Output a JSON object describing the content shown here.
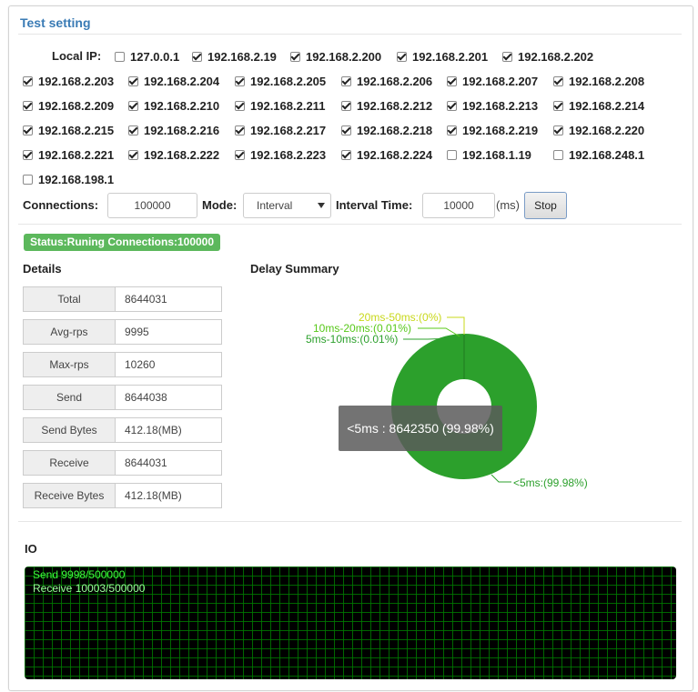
{
  "panel": {
    "title": "Test setting"
  },
  "local_ip": {
    "label": "Local IP:",
    "items": [
      {
        "ip": "127.0.0.1",
        "checked": false
      },
      {
        "ip": "192.168.2.19",
        "checked": true
      },
      {
        "ip": "192.168.2.200",
        "checked": true
      },
      {
        "ip": "192.168.2.201",
        "checked": true
      },
      {
        "ip": "192.168.2.202",
        "checked": true
      },
      {
        "ip": "192.168.2.203",
        "checked": true
      },
      {
        "ip": "192.168.2.204",
        "checked": true
      },
      {
        "ip": "192.168.2.205",
        "checked": true
      },
      {
        "ip": "192.168.2.206",
        "checked": true
      },
      {
        "ip": "192.168.2.207",
        "checked": true
      },
      {
        "ip": "192.168.2.208",
        "checked": true
      },
      {
        "ip": "192.168.2.209",
        "checked": true
      },
      {
        "ip": "192.168.2.210",
        "checked": true
      },
      {
        "ip": "192.168.2.211",
        "checked": true
      },
      {
        "ip": "192.168.2.212",
        "checked": true
      },
      {
        "ip": "192.168.2.213",
        "checked": true
      },
      {
        "ip": "192.168.2.214",
        "checked": true
      },
      {
        "ip": "192.168.2.215",
        "checked": true
      },
      {
        "ip": "192.168.2.216",
        "checked": true
      },
      {
        "ip": "192.168.2.217",
        "checked": true
      },
      {
        "ip": "192.168.2.218",
        "checked": true
      },
      {
        "ip": "192.168.2.219",
        "checked": true
      },
      {
        "ip": "192.168.2.220",
        "checked": true
      },
      {
        "ip": "192.168.2.221",
        "checked": true
      },
      {
        "ip": "192.168.2.222",
        "checked": true
      },
      {
        "ip": "192.168.2.223",
        "checked": true
      },
      {
        "ip": "192.168.2.224",
        "checked": true
      },
      {
        "ip": "192.168.1.19",
        "checked": false
      },
      {
        "ip": "192.168.248.1",
        "checked": false
      },
      {
        "ip": "192.168.198.1",
        "checked": false
      }
    ]
  },
  "controls": {
    "connections_label": "Connections:",
    "connections_value": "100000",
    "mode_label": "Mode:",
    "mode_value": "Interval",
    "interval_label": "Interval Time:",
    "interval_value": "10000",
    "interval_unit": "(ms)",
    "stop_label": "Stop"
  },
  "status": {
    "text": "Status:Runing Connections:100000",
    "color": "#5cb85c"
  },
  "details": {
    "title": "Details",
    "rows": [
      {
        "key": "Total",
        "value": "8644031"
      },
      {
        "key": "Avg-rps",
        "value": "9995"
      },
      {
        "key": "Max-rps",
        "value": "10260"
      },
      {
        "key": "Send",
        "value": "8644038"
      },
      {
        "key": "Send Bytes",
        "value": "412.18(MB)"
      },
      {
        "key": "Receive",
        "value": "8644031"
      },
      {
        "key": "Receive Bytes",
        "value": "412.18(MB)"
      }
    ]
  },
  "delay_summary": {
    "title": "Delay Summary"
  },
  "chart_data": {
    "type": "pie",
    "donut": true,
    "slices": [
      {
        "label": "<5ms:(99.98%)",
        "value": 99.98,
        "color": "#2ca02c"
      },
      {
        "label": "5ms-10ms:(0.01%)",
        "value": 0.01,
        "color": "#2ca02c"
      },
      {
        "label": "10ms-20ms:(0.01%)",
        "value": 0.01,
        "color": "#58c81a"
      },
      {
        "label": "20ms-50ms:(0%)",
        "value": 0,
        "color": "#c8d81a"
      }
    ],
    "tooltip": "<5ms : 8642350 (99.98%)"
  },
  "io": {
    "title": "IO",
    "send_text": "Send 9998/500000",
    "receive_text": "Receive 10003/500000",
    "grid_color": "#007800"
  }
}
